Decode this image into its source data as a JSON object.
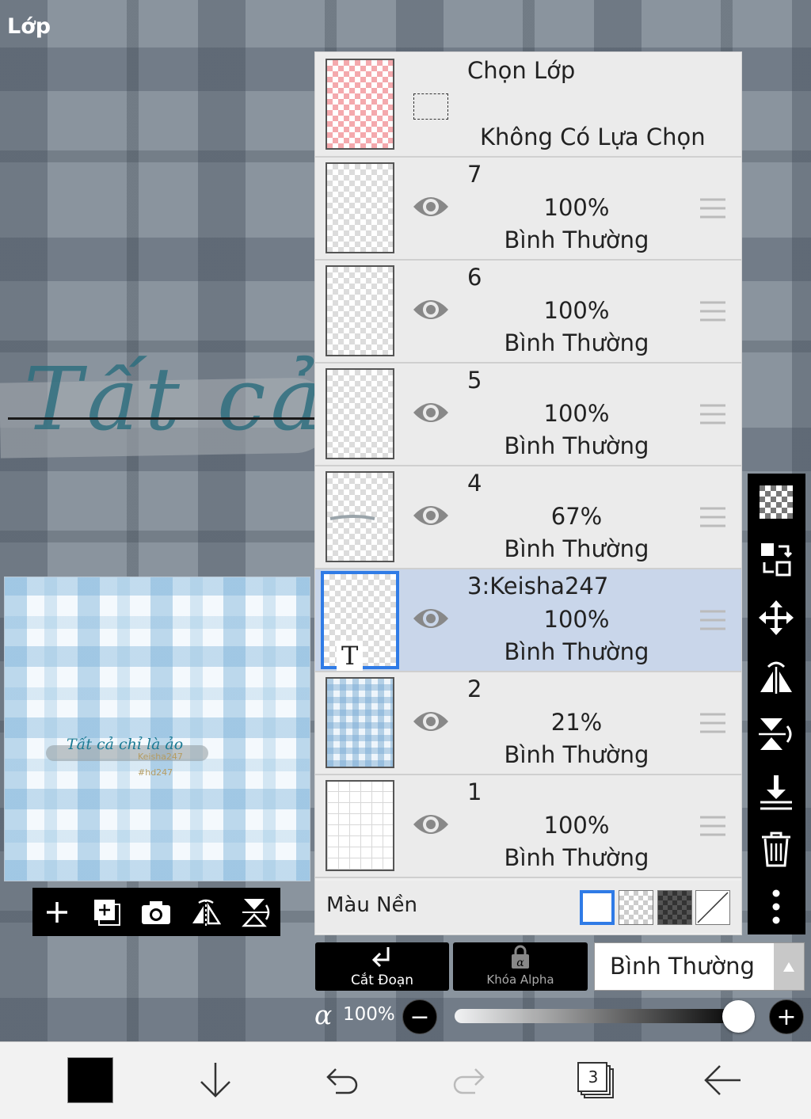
{
  "header": {
    "title": "Lớp"
  },
  "canvas": {
    "script_text": "Tất cả c"
  },
  "preview": {
    "script_text": "Tất cả chỉ là ảo",
    "text1": "Keisha247",
    "text2": "#hd247"
  },
  "selection": {
    "title": "Chọn Lớp",
    "subtitle": "Không Có Lựa Chọn"
  },
  "layers": [
    {
      "num": "7",
      "opacity": "100%",
      "blend": "Bình Thường"
    },
    {
      "num": "6",
      "opacity": "100%",
      "blend": "Bình Thường"
    },
    {
      "num": "5",
      "opacity": "100%",
      "blend": "Bình Thường"
    },
    {
      "num": "4",
      "opacity": "67%",
      "blend": "Bình Thường"
    },
    {
      "num": "3:Keisha247",
      "opacity": "100%",
      "blend": "Bình Thường",
      "active": true,
      "text_glyph": "T"
    },
    {
      "num": "2",
      "opacity": "21%",
      "blend": "Bình Thường"
    },
    {
      "num": "1",
      "opacity": "100%",
      "blend": "Bình Thường"
    }
  ],
  "background_color": {
    "label": "Màu Nền",
    "options": [
      "white",
      "transparent",
      "dark",
      "none"
    ]
  },
  "controls": {
    "clip_label": "Cắt Đoạn",
    "alpha_lock_label": "Khóa Alpha",
    "blend_mode": "Bình Thường",
    "alpha_symbol": "α",
    "alpha_value": "100%",
    "minus": "−",
    "plus": "+"
  },
  "bottom_bar": {
    "layer_count": "3"
  },
  "colors": {
    "accent": "#2f7be6",
    "active_row": "#c9d6ea",
    "toolbar": "#000000"
  },
  "icons": [
    "add-layer-icon",
    "add-copy-icon",
    "camera-icon",
    "flip-horizontal-icon",
    "flip-vertical-icon",
    "eye-icon",
    "drag-handle-icon",
    "checker-icon",
    "transform-icon",
    "move-icon",
    "merge-down-icon",
    "trash-icon",
    "more-icon",
    "undo-icon",
    "redo-icon",
    "back-icon",
    "down-arrow-icon"
  ]
}
